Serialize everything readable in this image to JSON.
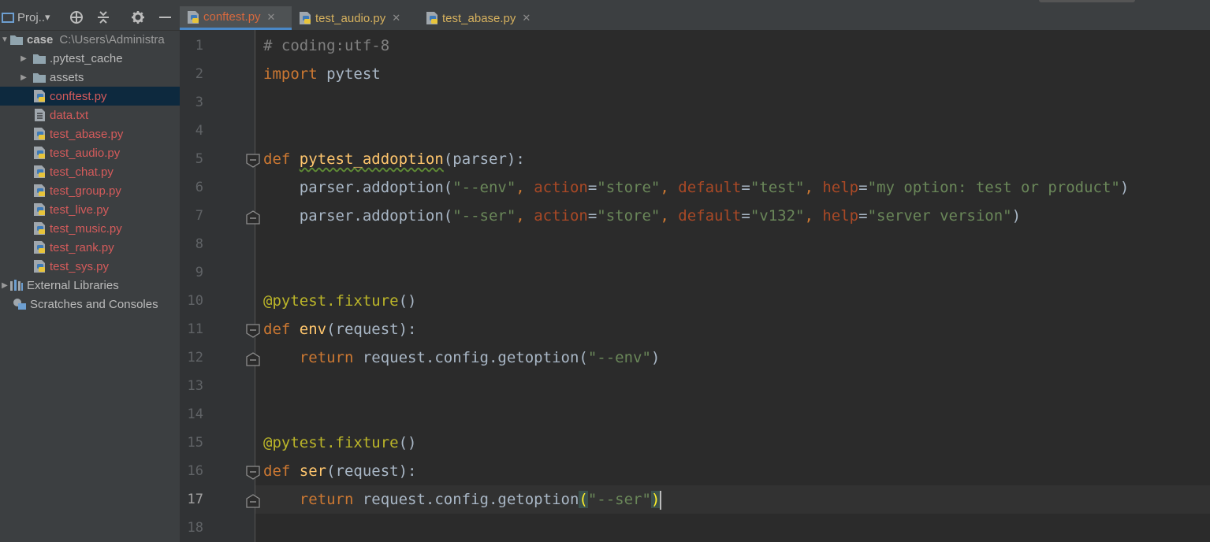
{
  "sidebar": {
    "toolbar": {
      "title": "Proj..",
      "dropdown": "▾"
    },
    "tree": [
      {
        "label": "case",
        "path": "C:\\Users\\Administra",
        "indent": 0,
        "arrow": "open",
        "icon": "folder",
        "color": "#bbbbbb",
        "bold": true
      },
      {
        "label": ".pytest_cache",
        "indent": 1,
        "arrow": "closed",
        "icon": "folder",
        "color": "#bbbbbb"
      },
      {
        "label": "assets",
        "indent": 1,
        "arrow": "closed",
        "icon": "folder",
        "color": "#bbbbbb"
      },
      {
        "label": "conftest.py",
        "indent": 1,
        "icon": "python-file",
        "color": "#d55b5b",
        "selected": true
      },
      {
        "label": "data.txt",
        "indent": 1,
        "icon": "text-file",
        "color": "#d55b5b"
      },
      {
        "label": "test_abase.py",
        "indent": 1,
        "icon": "python-file",
        "color": "#d55b5b"
      },
      {
        "label": "test_audio.py",
        "indent": 1,
        "icon": "python-file",
        "color": "#d55b5b"
      },
      {
        "label": "test_chat.py",
        "indent": 1,
        "icon": "python-file",
        "color": "#d55b5b"
      },
      {
        "label": "test_group.py",
        "indent": 1,
        "icon": "python-file",
        "color": "#d55b5b"
      },
      {
        "label": "test_live.py",
        "indent": 1,
        "icon": "python-file",
        "color": "#d55b5b"
      },
      {
        "label": "test_music.py",
        "indent": 1,
        "icon": "python-file",
        "color": "#d55b5b"
      },
      {
        "label": "test_rank.py",
        "indent": 1,
        "icon": "python-file",
        "color": "#d55b5b"
      },
      {
        "label": "test_sys.py",
        "indent": 1,
        "icon": "python-file",
        "color": "#d55b5b"
      },
      {
        "label": "External Libraries",
        "indent": 0,
        "arrow": "closed",
        "icon": "library",
        "color": "#bbbbbb"
      },
      {
        "label": "Scratches and Consoles",
        "indent": 0,
        "icon": "scratches",
        "color": "#bbbbbb"
      }
    ]
  },
  "tabs": [
    {
      "label": "conftest.py",
      "active": true
    },
    {
      "label": "test_audio.py",
      "active": false
    },
    {
      "label": "test_abase.py",
      "active": false
    }
  ],
  "editor": {
    "line_numbers": [
      "1",
      "2",
      "3",
      "4",
      "5",
      "6",
      "7",
      "8",
      "9",
      "10",
      "11",
      "12",
      "13",
      "14",
      "15",
      "16",
      "17",
      "18"
    ],
    "current_line": 17
  }
}
